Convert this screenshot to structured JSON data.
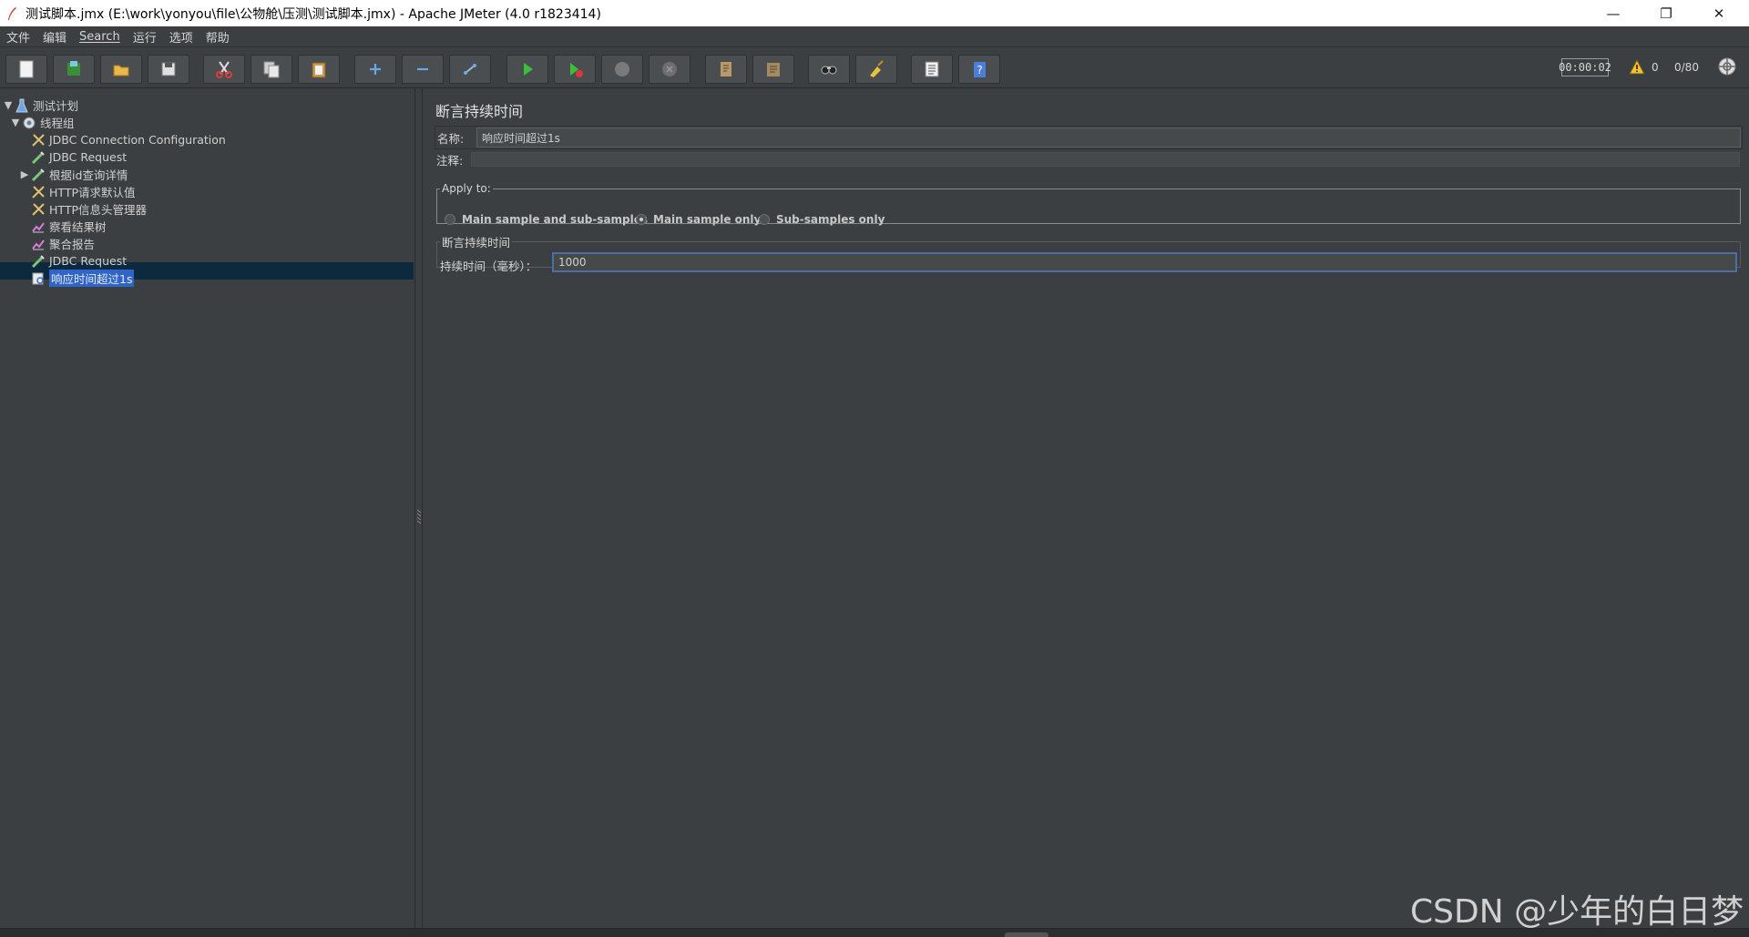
{
  "window": {
    "title": "测试脚本.jmx (E:\\work\\yonyou\\file\\公物舱\\压测\\测试脚本.jmx) - Apache JMeter (4.0 r1823414)",
    "controls": {
      "minimize": "—",
      "restore": "❐",
      "close": "✕"
    }
  },
  "menubar": [
    "文件",
    "编辑",
    "Search",
    "运行",
    "选项",
    "帮助"
  ],
  "toolbar": {
    "buttons": [
      {
        "icon": "new-icon"
      },
      {
        "icon": "templates-icon"
      },
      {
        "icon": "open-icon"
      },
      {
        "icon": "save-icon"
      },
      {
        "icon": "cut-icon"
      },
      {
        "icon": "copy-icon"
      },
      {
        "icon": "paste-icon"
      },
      {
        "icon": "expand-icon"
      },
      {
        "icon": "collapse-icon"
      },
      {
        "icon": "toggle-icon"
      },
      {
        "icon": "start-icon"
      },
      {
        "icon": "start-no-timers-icon"
      },
      {
        "icon": "stop-icon"
      },
      {
        "icon": "shutdown-icon"
      },
      {
        "icon": "remote-start-icon"
      },
      {
        "icon": "remote-stop-icon"
      },
      {
        "icon": "search-icon"
      },
      {
        "icon": "clear-icon"
      },
      {
        "icon": "function-helper-icon"
      },
      {
        "icon": "help-icon"
      }
    ],
    "timer": "00:00:02",
    "warnings": "0",
    "threads": "0/80"
  },
  "tree": {
    "items": [
      {
        "label": "测试计划",
        "icon": "test-plan-icon"
      },
      {
        "label": "线程组",
        "icon": "thread-group-icon"
      },
      {
        "label": "JDBC Connection Configuration",
        "icon": "config-element-icon"
      },
      {
        "label": "JDBC Request",
        "icon": "sampler-icon"
      },
      {
        "label": "根据id查询详情",
        "icon": "sampler-icon"
      },
      {
        "label": "HTTP请求默认值",
        "icon": "config-element-icon"
      },
      {
        "label": "HTTP信息头管理器",
        "icon": "config-element-icon"
      },
      {
        "label": "察看结果树",
        "icon": "listener-icon"
      },
      {
        "label": "聚合报告",
        "icon": "listener-icon"
      },
      {
        "label": "JDBC Request",
        "icon": "sampler-icon"
      },
      {
        "label": "响应时间超过1s",
        "icon": "assertion-icon"
      }
    ],
    "selected_index": 10
  },
  "editor": {
    "title": "断言持续时间",
    "name_label": "名称:",
    "name_value": "响应时间超过1s",
    "comment_label": "注释:",
    "apply_to": {
      "legend": "Apply to:",
      "options": [
        "Main sample and sub-samples",
        "Main sample only",
        "Sub-samples only"
      ],
      "selected": "Main sample only"
    },
    "duration": {
      "legend": "断言持续时间",
      "label": "持续时间（毫秒）：",
      "value": "1000"
    }
  },
  "watermark": "CSDN @少年的白日梦"
}
